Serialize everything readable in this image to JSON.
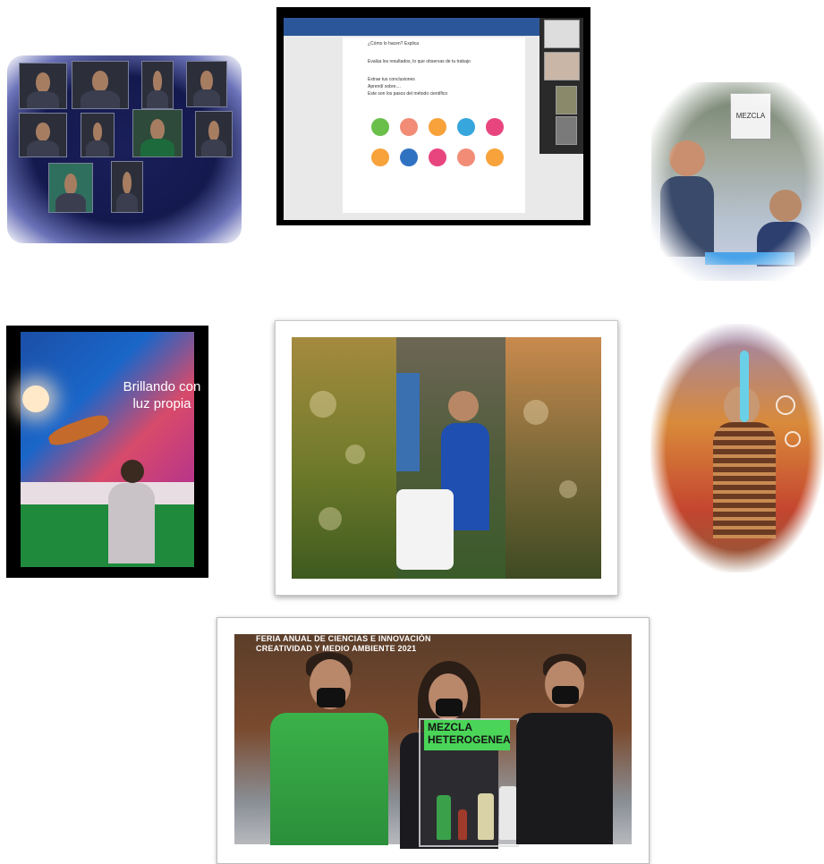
{
  "images": {
    "video_call": {
      "label": "video-call-grid"
    },
    "document": {
      "lines": [
        "¿Cómo lo hacen? Explica",
        "Evalúa los resultados, lo que observas de tu trabajo",
        "Extrae tus conclusiones",
        "Aprendí sobre....",
        "Este son los pasos del método científico"
      ],
      "steps_row1_colors": [
        "#6abf4b",
        "#f28c77",
        "#f7a23b",
        "#37a6dc",
        "#e8457f"
      ],
      "steps_row2_colors": [
        "#f7a23b",
        "#2f72c2",
        "#e8457f",
        "#f28c77",
        "#f7a23b"
      ]
    },
    "presentation": {
      "title": "Brillando con luz propia"
    },
    "science_fair": {
      "banner_line1": "FERIA ANUAL DE CIENCIAS E INNOVACIÓN",
      "banner_line2": "CREATIVIDAD Y MEDIO AMBIENTE 2021",
      "sign_line1": "MEZCLA",
      "sign_line2": "HETEROGENEA"
    },
    "kids_table": {
      "sign": "MEZCLA"
    }
  }
}
